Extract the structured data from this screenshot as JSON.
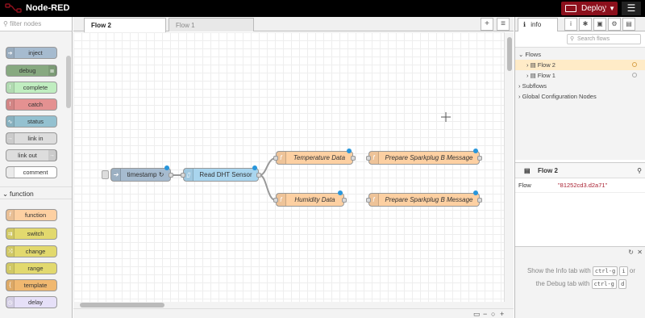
{
  "header": {
    "app_name": "Node-RED",
    "deploy_label": "Deploy",
    "menu_icon": "hamburger-menu-icon",
    "deploy_color": "#8c101c"
  },
  "palette": {
    "filter_placeholder": "filter nodes",
    "nodes": [
      {
        "label": "inject",
        "color": "#a6bbcf"
      },
      {
        "label": "debug",
        "color": "#87a980"
      },
      {
        "label": "complete",
        "color": "#c0edc0"
      },
      {
        "label": "catch",
        "color": "#e49191"
      },
      {
        "label": "status",
        "color": "#94c1d0"
      },
      {
        "label": "link in",
        "color": "#dddddd"
      },
      {
        "label": "link out",
        "color": "#dddddd"
      },
      {
        "label": "comment",
        "color": "#ffffff"
      }
    ],
    "category_function": "function",
    "function_nodes": [
      {
        "label": "function",
        "color": "#fdd0a2"
      },
      {
        "label": "switch",
        "color": "#e2d96e"
      },
      {
        "label": "change",
        "color": "#e2d96e"
      },
      {
        "label": "range",
        "color": "#e2d96e"
      },
      {
        "label": "template",
        "color": "#f0b870"
      },
      {
        "label": "delay",
        "color": "#e6e0f8"
      }
    ]
  },
  "workspace": {
    "tabs": [
      {
        "label": "Flow 2",
        "active": true
      },
      {
        "label": "Flow 1",
        "active": false
      }
    ],
    "add_tab": "+",
    "list_tabs": "≡",
    "flow_nodes": {
      "timestamp": "timestamp ↻",
      "dht": "Read DHT Sensor",
      "temp": "Temperature Data",
      "humidity": "Humidity Data",
      "sparkplug1": "Prepare Sparkplug B Message",
      "sparkplug2": "Prepare Sparkplug B Message"
    },
    "zoom_out": "−",
    "zoom_reset": "○",
    "zoom_in": "+"
  },
  "sidebar": {
    "tab_info": "info",
    "search_placeholder": "Search flows",
    "tree": {
      "flows": "Flows",
      "flow2": "Flow 2",
      "flow1": "Flow 1",
      "subflows": "Subflows",
      "global": "Global Configuration Nodes"
    },
    "props_title": "Flow 2",
    "prop_label": "Flow",
    "prop_value": "\"81252cd3.d2a71\"",
    "help": {
      "line1_a": "Show the Info tab with",
      "key1a": "ctrl-g",
      "key1b": "i",
      "line1_b": "or",
      "line2_a": "the Debug tab with",
      "key2a": "ctrl-g",
      "key2b": "d"
    }
  }
}
